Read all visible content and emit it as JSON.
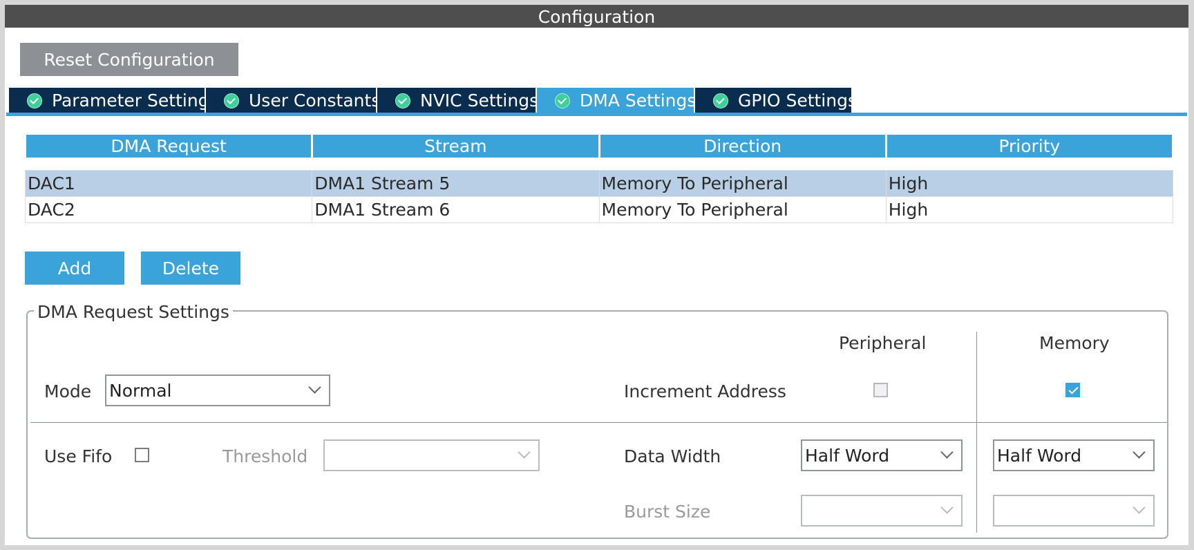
{
  "window": {
    "title": "Configuration"
  },
  "toolbar": {
    "reset_label": "Reset Configuration"
  },
  "tabs": [
    {
      "label": "Parameter Settings",
      "active": false
    },
    {
      "label": "User Constants",
      "active": false
    },
    {
      "label": "NVIC Settings",
      "active": false
    },
    {
      "label": "DMA Settings",
      "active": true
    },
    {
      "label": "GPIO Settings",
      "active": false
    }
  ],
  "dma_table": {
    "headers": [
      "DMA Request",
      "Stream",
      "Direction",
      "Priority"
    ],
    "rows": [
      {
        "request": "DAC1",
        "stream": "DMA1 Stream 5",
        "direction": "Memory To Peripheral",
        "priority": "High",
        "selected": true
      },
      {
        "request": "DAC2",
        "stream": "DMA1 Stream 6",
        "direction": "Memory To Peripheral",
        "priority": "High",
        "selected": false
      }
    ]
  },
  "actions": {
    "add_label": "Add",
    "delete_label": "Delete"
  },
  "request_settings": {
    "legend": "DMA Request Settings",
    "mode_label": "Mode",
    "mode_value": "Normal",
    "use_fifo_label": "Use Fifo",
    "use_fifo_checked": false,
    "threshold_label": "Threshold",
    "threshold_value": "",
    "peripheral_header": "Peripheral",
    "memory_header": "Memory",
    "increment_address_label": "Increment Address",
    "peripheral_increment": false,
    "memory_increment": true,
    "data_width_label": "Data Width",
    "peripheral_data_width": "Half Word",
    "memory_data_width": "Half Word",
    "burst_size_label": "Burst Size",
    "peripheral_burst_size": "",
    "memory_burst_size": ""
  },
  "colors": {
    "accent": "#3aa3d9",
    "tab_dark": "#0a2c4e",
    "title_bar": "#4e4e4e",
    "selected_row": "#b9cfe6",
    "check_green": "#3ecf9a"
  }
}
